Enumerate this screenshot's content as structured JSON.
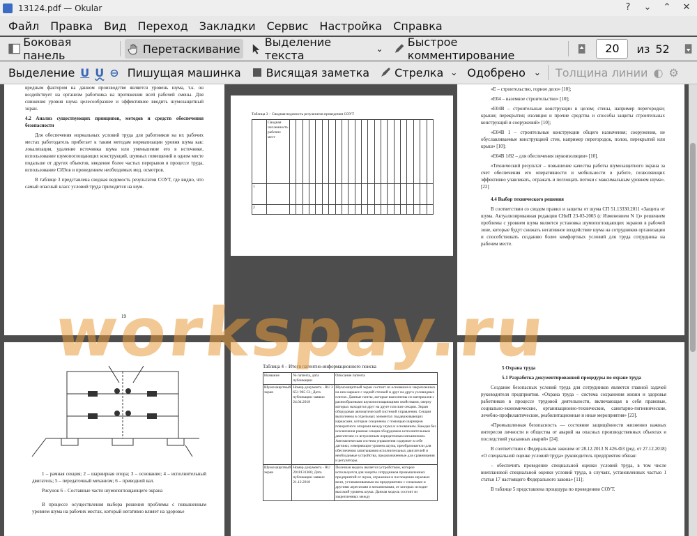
{
  "window": {
    "title": "13124.pdf  — Okular"
  },
  "menu": [
    "Файл",
    "Правка",
    "Вид",
    "Переход",
    "Закладки",
    "Сервис",
    "Настройка",
    "Справка"
  ],
  "toolbar1": {
    "sidebar": "Боковая панель",
    "drag": "Перетаскивание",
    "text_select": "Выделение текста",
    "quick_comment": "Быстрое комментирование",
    "page_current": "20",
    "page_of": "из",
    "page_total": "52"
  },
  "toolbar2": {
    "highlight": "Выделение",
    "typewriter": "Пишущая машинка",
    "note": "Висящая заметка",
    "arrow": "Стрелка",
    "approved": "Одобрено",
    "line_width": "Толщина линии"
  },
  "watermark": "workspay.ru",
  "page19": {
    "p1": "вредным фактором на данном производстве является уровень шума, т.к. он воздействует на организм работника на протяжении всей рабочей смены. Для снижения уровня шума целесообразнее и эффективнее вводить шумозащитный экран.",
    "heading": "4.2 Анализ существующих принципов, методов и средств обеспечения безопасности",
    "p2": "Для обеспечения нормальных условий труда для работников на их рабочих местах работодатель прибегает к таким методам нормализации уровня шума как: локализация, удаление источника шума или уменьшение его в источнике, использование шумопоглощающих конструкций, шумных помещений в одном месте подальше от других объектов, введение более частых перерывов в процессе труда, использование СИЗов и проведением необходимых мед. осмотров.",
    "p3": "В таблице 3 представлена сводная ведомость результатов СОУТ, где видно, что самый опасный класс условий труда приходится на шум.",
    "num": "19"
  },
  "page20": {
    "caption": "Таблица 3 – Сводная ведомость результатов проведения СОУТ",
    "row1": "Сводная численность рабочих мест",
    "row2": "1",
    "row3": "2"
  },
  "page21": {
    "l1": "«Е – строительство, горное дело» [10];",
    "l2": "«Е04 – наземное строительство» [10];",
    "l3": "«Е04В – строительные конструкции в целом; стены, например перегородки; крыши; перекрытия; изоляция и прочие средства и способы защиты строительных конструкций и сооружений» [10];",
    "l4": "«Е04В 1 – строительные конструкции общего назначения; сооружения, не обуславливаемые конструкцией стен, например перегородок, полов, перекрытий или крыш» [10];",
    "l5": "«Е04В 1/82 – для обеспечения звукоизоляции» [10].",
    "l6": "«Технический результат – повышение качества работы шумозащитного экрана за счет обеспечения его оперативности и мобильности в работе, позволяющих эффективно улавливать, отражать и поглощать потоки с максимальным уровнем шума». [22]",
    "heading": "4.4 Выбор технического решения",
    "p1": "В соответствии со сводом правил и защиты от шума СП 51.13330.2011 «Защита от шума. Актуализированная редакция СНиП 23-03-2003 (с Изменением N 1)» решением проблемы с уровнем шума является установка шумопоглощающих экранов в рабочей зоне, которые будут снижать негативное воздействие шума на сотрудников организации и способствовать созданию более комфортных условий для труда сотрудника на рабочем месте."
  },
  "page22": {
    "legend": "1 – рамная секция; 2 – шарнирная опора; 3 – основание; 4 – исполнительный двигатель; 5 – передаточный механизм; 6 – приводной вал.",
    "caption": "Рисунок 6 – Составные части шумопоглощающего экрана",
    "p1": "В процессе осуществления выбора решения проблемы с повышенным уровнем шума на рабочих местах, который негативно влияет на здоровье"
  },
  "page23": {
    "caption": "Таблица 4 – Итоги патентно-информационного поиска",
    "h1": "Название",
    "h2": "№ патента, дата публикации",
    "h3": "Описание патента",
    "r1c1": "Шумозащитный экран",
    "r1c2": "Номер документа - RU 2 651 965 C1; Дата публикации заявки: 24.04.2018",
    "r1c3": "Шумозащитный экран состоит из основания и закрепленных на нем каркасе с задней стенкой и друг на друга узловидных плитах. Данные плиты, которые выполнены из материалов с разнообразными шумопоглощающими свойствами, сверху которых находится друг на друге плоские секции. Экран оборудован автоматической системой управления. Секции выполнены в отдельных элементах поддерживающих каркасами, которые соединены с помощью шарниров поворотного опорами между шума и основанием. Каждая без исключения рамная секция оборудована исполнительным двигателем со встроенным передаточным механизмом. Автоматическая система управления содержит в себе датчики, измеряющие уровень шума, преобразователи для обеспечения запитывания исполнительных двигателей и необходимые устройства, предназначенные для сравнивания и регуляторы.",
    "r2c1": "Шумозащитный экран",
    "r2c2": "Номер документа - RU 2018131366; Дата публикации заявки: 21.12.2018",
    "r2c3": "Полезная модель является устройством, которое используется для защиты сотрудников промышленных предприятий от шума, отражения и поглощения звуковых волн, устанавливаемым на предприятиях с сильными и другими агрегатами и механизмами, от которых исходит высокий уровень шума. Данная модель состоит из закрепленных между"
  },
  "page24": {
    "h1": "5 Охрана труда",
    "h2": "5.1 Разработка документированной процедуры по охране труда",
    "p1": "Создание безопасных условий труда для сотрудников является главной задачей руководителя предприятия. «Охрана труда – система сохранения жизни и здоровья работников в процессе трудовой деятельности, включающая в себя правовые, социально-экономические, организационно-технические, санитарно-гигиенические, лечебно-профилактические, реабилитационные и иные мероприятия» [23].",
    "p2": "«Промышленная безопасность — состояние защищённости жизненно важных интересов личности и общества от аварий на опасных производственных объектах и последствий указанных аварий» [24].",
    "p3": "В соответствии с Федеральным законом от 28.12.2013 N 426-ФЗ (ред. от 27.12.2018) «О специальной оценке условий труда» руководитель предприятия обязан:",
    "p4": "– обеспечить проведение специальной оценки условий труда, в том числе внеплановой специальной оценки условий труда, в случаях, установленных частью 1 статьи 17 настоящего Федерального закона» [11];",
    "p5": "В таблице 5 представлена процедура по проведению СОУТ."
  }
}
